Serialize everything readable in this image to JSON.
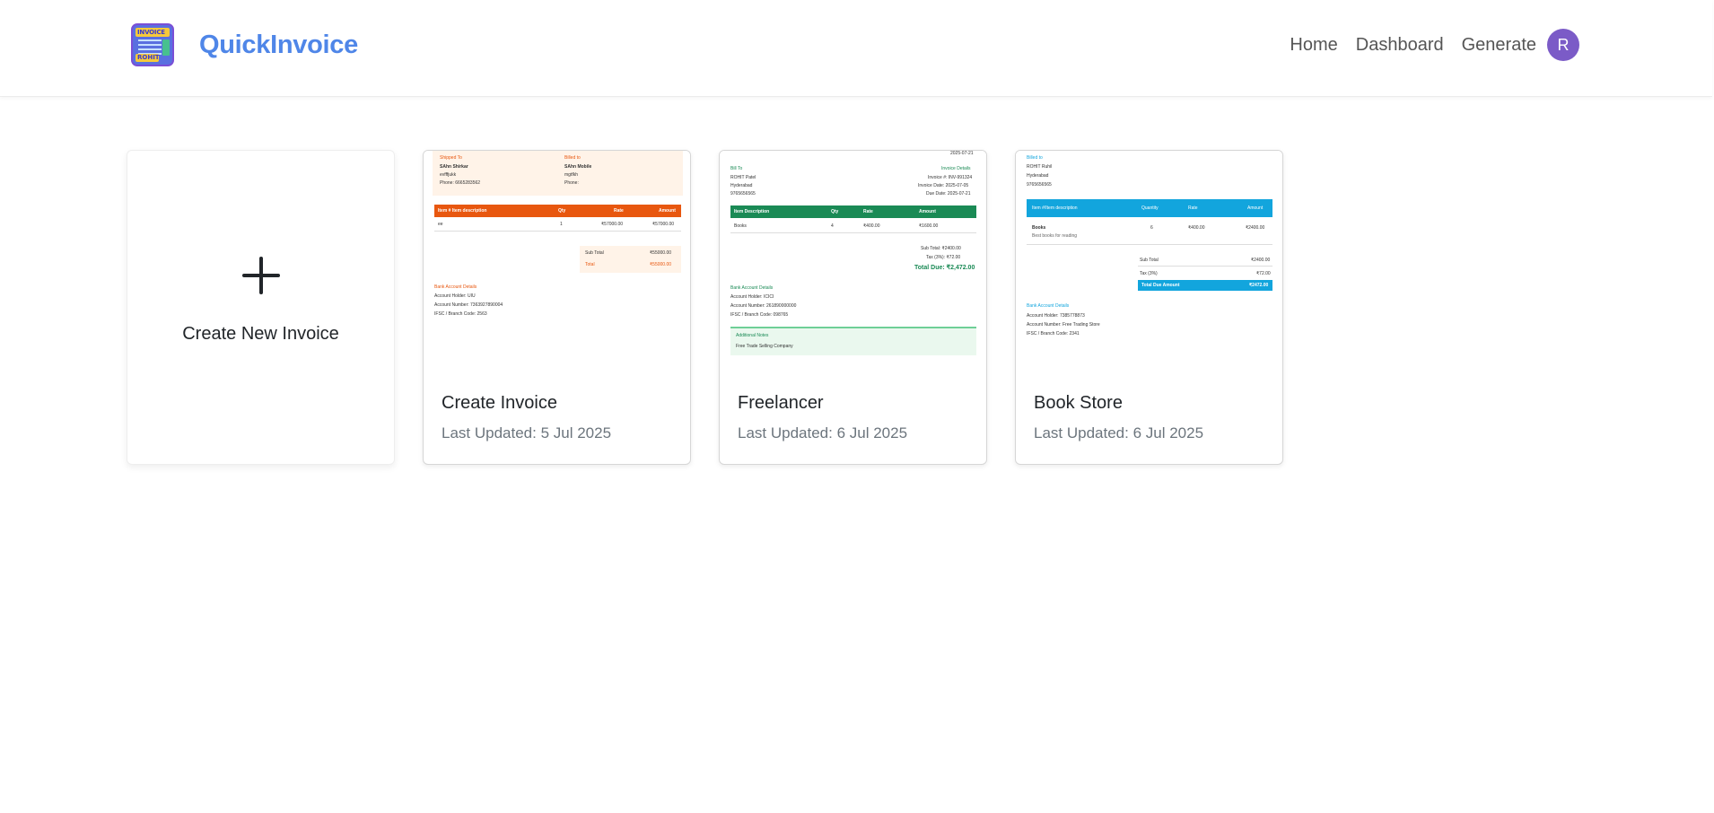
{
  "app": {
    "brand_name": "QuickInvoice",
    "logo_top_text": "INVOICE",
    "logo_bottom_text": "ROHIT",
    "accent_color": "#4f86e8"
  },
  "nav": {
    "home": "Home",
    "dashboard": "Dashboard",
    "generate": "Generate",
    "avatar_initial": "R"
  },
  "create_card": {
    "icon": "plus-icon",
    "label": "Create New Invoice"
  },
  "invoices": [
    {
      "title": "Create Invoice",
      "updated": "Last Updated: 5 Jul 2025",
      "theme_color": "#e8570f",
      "thumb": {
        "shipped_label": "Shipped To",
        "shipped_name": "SAhn Shirkar",
        "shipped_line": "evfffjukk",
        "shipped_phone": "Phone: 6665283562",
        "billed_label": "Billed to",
        "billed_name": "SAhn Mobile",
        "billed_line": "mgtfkh",
        "billed_phone": "Phone:",
        "col_item": "Item # Item description",
        "col_qty": "Qty",
        "col_rate": "Rate",
        "col_amount": "Amount",
        "row_item": "ee",
        "row_qty": "1",
        "row_rate": "₹57000.00",
        "row_amount": "₹57000.00",
        "subtotal_label": "Sub Total",
        "subtotal_value": "₹55000.00",
        "total_label": "Total",
        "total_value": "₹55000.00",
        "bank_title": "Bank Account Details",
        "bank_holder": "Account Holder: UIU",
        "bank_number": "Account Number: 7363927890004",
        "bank_ifsc": "IFSC / Branch Code: 2563"
      }
    },
    {
      "title": "Freelancer",
      "updated": "Last Updated: 6 Jul 2025",
      "theme_color": "#1a8a55",
      "thumb": {
        "top_right": "2025-07-21",
        "billto_label": "Bill To",
        "bill_name": "ROHIT Patel",
        "bill_city": "Hyderabad",
        "bill_phone": "9765656565",
        "details_label": "Invoice Details",
        "invoice_no": "Invoice #: INV-991324",
        "invoice_date": "Invoice Date: 2025-07-05",
        "due_date": "Due Date: 2025-07-21",
        "col_item": "Item Description",
        "col_qty": "Qty",
        "col_rate": "Rate",
        "col_amount": "Amount",
        "row_item": "Books",
        "row_qty": "4",
        "row_rate": "₹400.00",
        "row_amount": "₹1600.00",
        "subtotal": "Sub Total: ₹2400.00",
        "tax": "Tax (3%): ₹72.00",
        "total_due": "Total Due: ₹2,472.00",
        "bank_title": "Bank Account Details",
        "bank_holder": "Account Holder: ICICI",
        "bank_number": "Account Number: 261890000000",
        "bank_ifsc": "IFSC / Branch Code: 098765",
        "notes_title": "Additional Notes",
        "notes_text": "Free Trade Selling Company"
      }
    },
    {
      "title": "Book Store",
      "updated": "Last Updated: 6 Jul 2025",
      "theme_color": "#12a5dd",
      "thumb": {
        "billto_label": "Billed to",
        "bill_name": "ROHIT Ruhil",
        "bill_city": "Hyderabad",
        "bill_phone": "9765656565",
        "col_item": "Item #/Item description",
        "col_qty": "Quantity",
        "col_rate": "Rate",
        "col_amount": "Amount",
        "row_item": "Books",
        "row_desc": "Best books for reading",
        "row_qty": "6",
        "row_rate": "₹400.00",
        "row_amount": "₹2400.00",
        "subtotal_label": "Sub Total",
        "subtotal_value": "₹2400.00",
        "tax_label": "Tax (3%)",
        "tax_value": "₹72.00",
        "total_label": "Total Due Amount",
        "total_value": "₹2472.00",
        "bank_title": "Bank Account Details",
        "bank_holder": "Account Holder: 7385778873",
        "bank_number": "Account Number: Free Trading Store",
        "bank_ifsc": "IFSC / Branch Code: 2341"
      }
    }
  ]
}
